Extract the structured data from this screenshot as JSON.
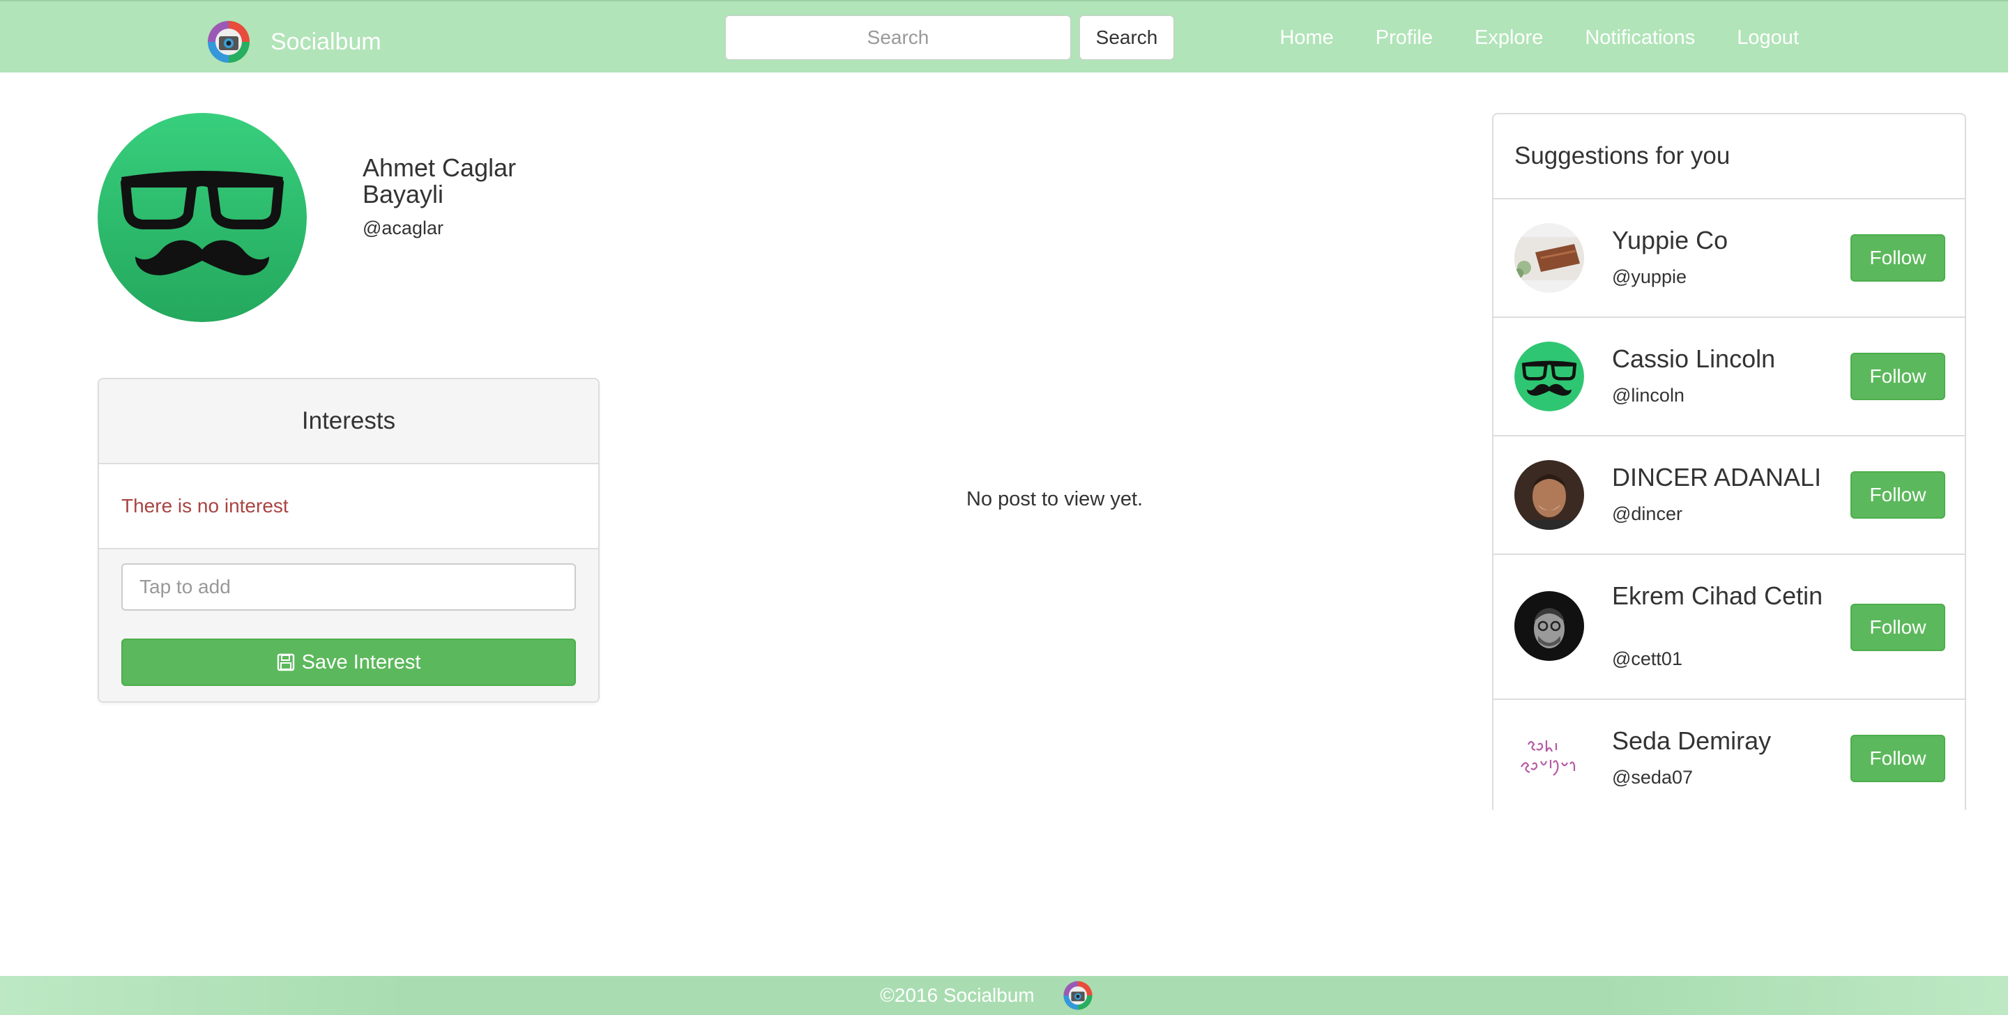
{
  "navbar": {
    "brand": "Socialbum",
    "search_placeholder": "Search",
    "search_button": "Search",
    "links": [
      "Home",
      "Profile",
      "Explore",
      "Notifications",
      "Logout"
    ]
  },
  "profile": {
    "name": "Ahmet Caglar Bayayli",
    "handle": "@acaglar"
  },
  "interests": {
    "title": "Interests",
    "empty_message": "There is no interest",
    "input_placeholder": "Tap to add",
    "save_label": "Save Interest"
  },
  "feed": {
    "empty_message": "No post to view yet."
  },
  "suggestions": {
    "title": "Suggestions for you",
    "follow_label": "Follow",
    "items": [
      {
        "name": "Yuppie Co",
        "handle": "@yuppie"
      },
      {
        "name": "Cassio Lincoln",
        "handle": "@lincoln"
      },
      {
        "name": "DINCER ADANALI",
        "handle": "@dincer"
      },
      {
        "name": "Ekrem Cihad Cetin",
        "handle": "@cett01"
      },
      {
        "name": "Seda Demiray",
        "handle": "@seda07"
      }
    ]
  },
  "footer": {
    "copyright": "©2016 Socialbum"
  },
  "colors": {
    "navbar": "#b1e4b8",
    "accent_green": "#5cb85c",
    "error_text": "#a94442",
    "avatar_green": "#2ec672"
  }
}
